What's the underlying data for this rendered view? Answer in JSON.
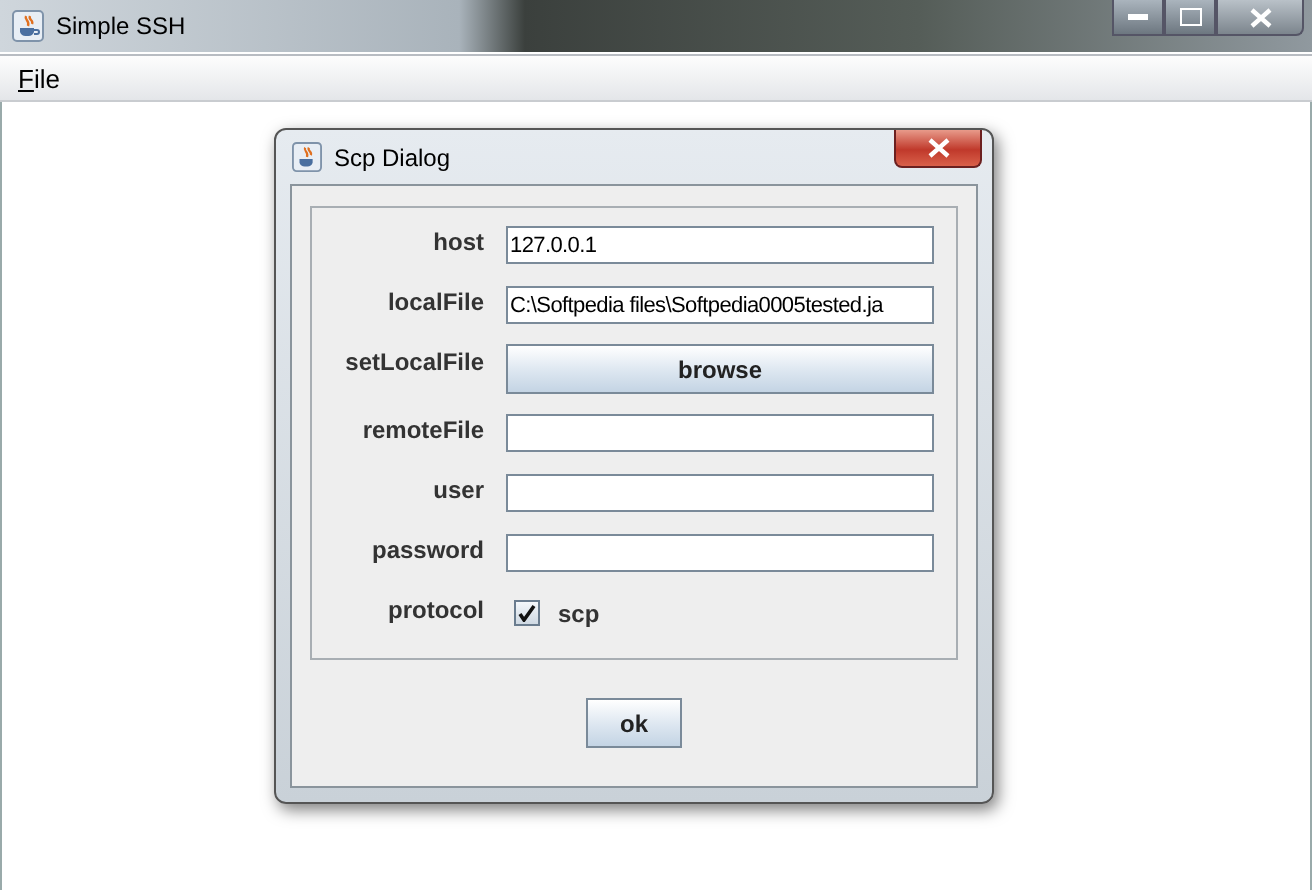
{
  "window": {
    "title": "Simple SSH"
  },
  "menu": [
    {
      "label": "File"
    }
  ],
  "dialog": {
    "title": "Scp Dialog",
    "rows": [
      {
        "kind": "field",
        "label": "host",
        "value": "127.0.0.1"
      },
      {
        "kind": "field",
        "label": "localFile",
        "value": "C:\\Softpedia files\\Softpedia0005tested.ja"
      },
      {
        "kind": "button",
        "label": "setLocalFile",
        "button": "browse"
      },
      {
        "kind": "field",
        "label": "remoteFile",
        "value": ""
      },
      {
        "kind": "field",
        "label": "user",
        "value": ""
      },
      {
        "kind": "field",
        "label": "password",
        "value": ""
      },
      {
        "kind": "checkbox",
        "label": "protocol",
        "text": "scp",
        "checked": true
      }
    ],
    "ok_button": "ok"
  }
}
